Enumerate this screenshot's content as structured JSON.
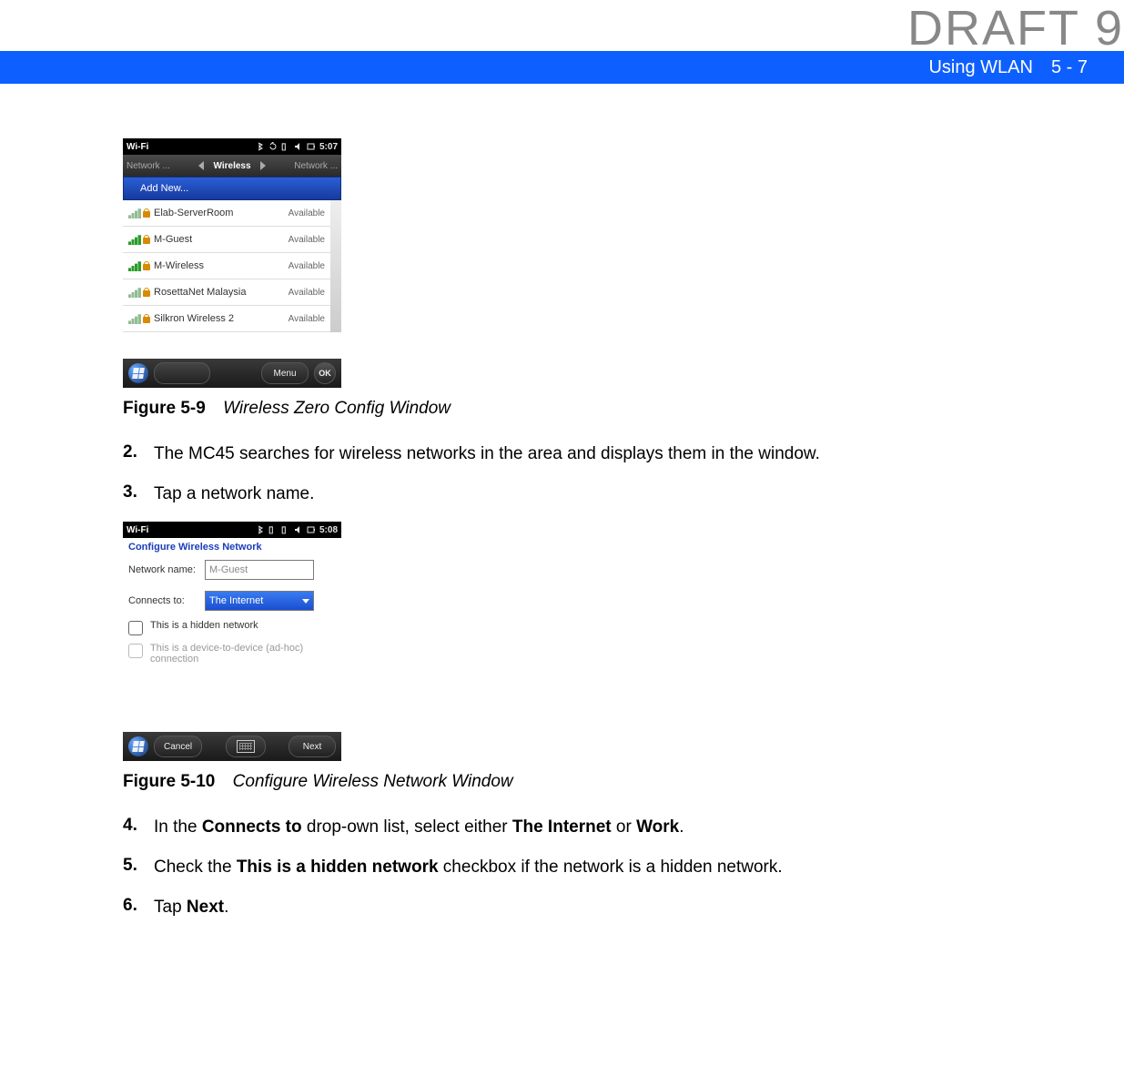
{
  "watermark": "DRAFT 9",
  "header": {
    "title": "Using WLAN",
    "page": "5 - 7"
  },
  "figure1": {
    "label": "Figure 5-9",
    "caption": "Wireless Zero Config Window"
  },
  "figure2": {
    "label": "Figure 5-10",
    "caption": "Configure Wireless Network Window"
  },
  "steps": {
    "s2": {
      "num": "2.",
      "text": "The MC45 searches for wireless networks in the area and displays them in the window."
    },
    "s3": {
      "num": "3.",
      "text": "Tap a network name."
    },
    "s4": {
      "num": "4.",
      "pre": "In the ",
      "b1": "Connects to",
      "mid1": " drop-own list, select either ",
      "b2": "The Internet",
      "mid2": " or ",
      "b3": "Work",
      "post": "."
    },
    "s5": {
      "num": "5.",
      "pre": "Check the ",
      "b1": "This is a hidden network",
      "post": " checkbox if the network is a hidden network."
    },
    "s6": {
      "num": "6.",
      "pre": "Tap ",
      "b1": "Next",
      "post": "."
    }
  },
  "screenshot1": {
    "status_title": "Wi-Fi",
    "time": "5:07",
    "tab_left": "Network ...",
    "tab_center": "Wireless",
    "tab_right": "Network ...",
    "add_new": "Add New...",
    "networks": [
      {
        "name": "Elab-ServerRoom",
        "status": "Available",
        "secure": true
      },
      {
        "name": "M-Guest",
        "status": "Available",
        "secure": true
      },
      {
        "name": "M-Wireless",
        "status": "Available",
        "secure": true
      },
      {
        "name": "RosettaNet Malaysia",
        "status": "Available",
        "secure": true
      },
      {
        "name": "Silkron Wireless 2",
        "status": "Available",
        "secure": true
      }
    ],
    "menu_label": "Menu",
    "ok_label": "OK"
  },
  "screenshot2": {
    "status_title": "Wi-Fi",
    "time": "5:08",
    "form_title": "Configure Wireless Network",
    "network_name_label": "Network name:",
    "network_name_value": "M-Guest",
    "connects_to_label": "Connects to:",
    "connects_to_value": "The Internet",
    "hidden_label": "This is a hidden network",
    "adhoc_label": "This is a device-to-device (ad-hoc) connection",
    "cancel_label": "Cancel",
    "next_label": "Next"
  }
}
